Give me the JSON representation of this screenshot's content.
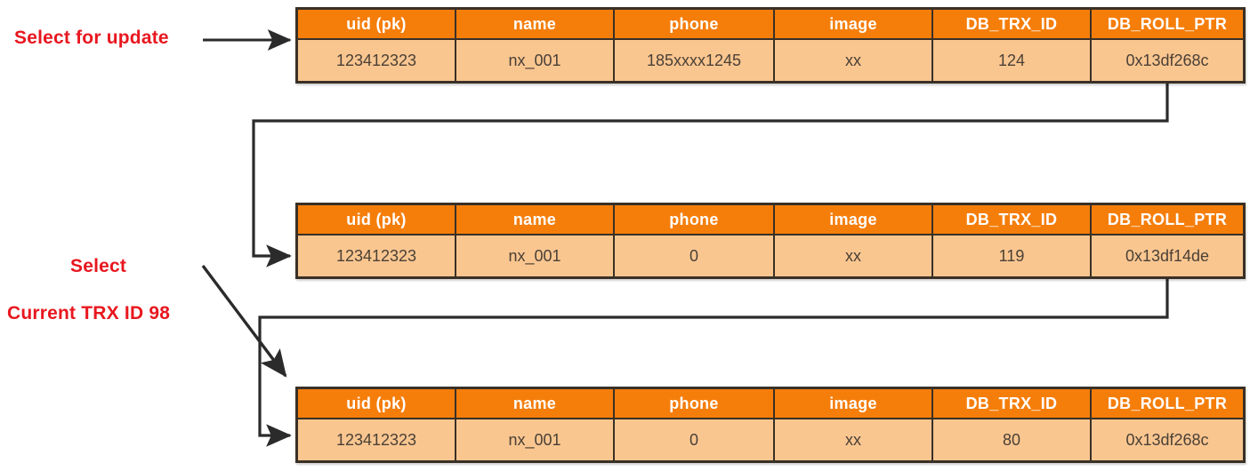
{
  "diagram": {
    "title": "MySQL MVCC undo log version chain",
    "accent_color": "#F57E0B",
    "cell_color": "#FAC690",
    "border_color": "#3a3026",
    "annotation_color": "#E8171F"
  },
  "annotations": [
    {
      "id": "select-for-update",
      "text": "Select for update"
    },
    {
      "id": "select",
      "text": "Select"
    },
    {
      "id": "current-trx",
      "text": "Current TRX  ID 98"
    }
  ],
  "columns": [
    "uid  (pk)",
    "name",
    "phone",
    "image",
    "DB_TRX_ID",
    "DB_ROLL_PTR"
  ],
  "tables": [
    {
      "name": "record-version-current",
      "row": [
        "123412323",
        "nx_001",
        "185xxxx1245",
        "xx",
        "124",
        "0x13df268c"
      ]
    },
    {
      "name": "record-version-119",
      "row": [
        "123412323",
        "nx_001",
        "0",
        "xx",
        "119",
        "0x13df14de"
      ]
    },
    {
      "name": "record-version-80",
      "row": [
        "123412323",
        "nx_001",
        "0",
        "xx",
        "80",
        "0x13df268c"
      ]
    }
  ],
  "connectors": [
    {
      "name": "rollptr-link-1",
      "from": "record-version-current",
      "to": "record-version-119"
    },
    {
      "name": "rollptr-link-2",
      "from": "record-version-119",
      "to": "record-version-80"
    },
    {
      "name": "select-for-update-arrow",
      "from": "select-for-update",
      "to": "record-version-current"
    },
    {
      "name": "select-arrow",
      "from": "select",
      "to": "record-version-80"
    }
  ]
}
